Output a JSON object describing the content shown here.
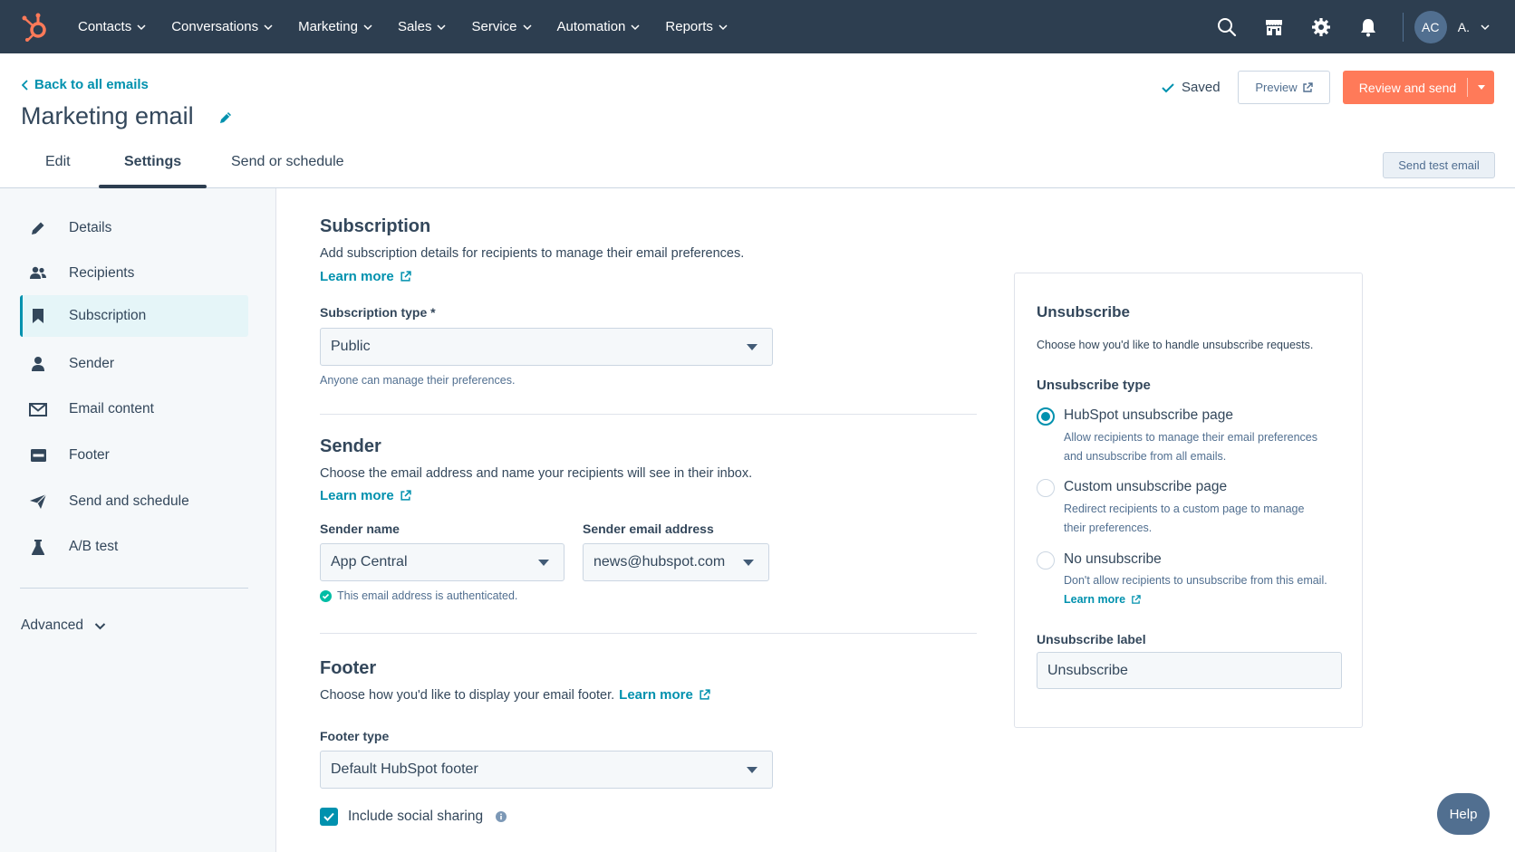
{
  "nav": {
    "menu": [
      "Contacts",
      "Conversations",
      "Marketing",
      "Sales",
      "Service",
      "Automation",
      "Reports"
    ],
    "avatar_initials": "AC",
    "account_name": "A.",
    "brand_color": "#ff7a59",
    "bar_color": "#2d3e50"
  },
  "header": {
    "back_label": "Back to all emails",
    "title": "Marketing email",
    "saved_label": "Saved",
    "preview_label": "Preview",
    "review_label": "Review and send"
  },
  "tabs": {
    "items": [
      "Edit",
      "Settings",
      "Send or schedule"
    ],
    "active": "Settings",
    "send_test_label": "Send test email"
  },
  "sidebar": {
    "items": [
      {
        "label": "Details",
        "icon": "pencil-icon"
      },
      {
        "label": "Recipients",
        "icon": "people-icon"
      },
      {
        "label": "Subscription",
        "icon": "bookmark-icon"
      },
      {
        "label": "Sender",
        "icon": "person-icon"
      },
      {
        "label": "Email content",
        "icon": "envelope-icon"
      },
      {
        "label": "Footer",
        "icon": "footer-icon"
      },
      {
        "label": "Send and schedule",
        "icon": "paper-plane-icon"
      },
      {
        "label": "A/B test",
        "icon": "flask-icon"
      }
    ],
    "active": "Subscription",
    "advanced_label": "Advanced"
  },
  "subscription": {
    "heading": "Subscription",
    "description": "Add subscription details for recipients to manage their email preferences.",
    "learn_more": "Learn more",
    "type_label": "Subscription type *",
    "type_value": "Public",
    "type_help": "Anyone can manage their preferences."
  },
  "sender": {
    "heading": "Sender",
    "description": "Choose the email address and name your recipients will see in their inbox.",
    "learn_more": "Learn more",
    "name_label": "Sender name",
    "name_value": "App Central",
    "email_label": "Sender email address",
    "email_value": "news@hubspot.com",
    "auth_text": "This email address is authenticated."
  },
  "footer": {
    "heading": "Footer",
    "description": "Choose how you'd like to display your email footer.",
    "learn_more": "Learn more",
    "type_label": "Footer type",
    "type_value": "Default HubSpot footer",
    "social_label": "Include social sharing",
    "social_checked": true
  },
  "unsubscribe": {
    "heading": "Unsubscribe",
    "description": "Choose how you'd like to handle unsubscribe requests.",
    "type_label": "Unsubscribe type",
    "options": [
      {
        "label": "HubSpot unsubscribe page",
        "desc1": "Allow recipients to manage their email preferences",
        "desc2": "and unsubscribe from all emails.",
        "checked": true
      },
      {
        "label": "Custom unsubscribe page",
        "desc1": "Redirect recipients to a custom page to manage",
        "desc2": "their preferences.",
        "checked": false
      },
      {
        "label": "No unsubscribe",
        "desc1": "Don't allow recipients to unsubscribe from this email.",
        "desc2": "",
        "checked": false
      }
    ],
    "learn_more": "Learn more",
    "label_label": "Unsubscribe label",
    "label_value": "Unsubscribe"
  },
  "help_label": "Help",
  "colors": {
    "link": "#0091ae",
    "text": "#33475b",
    "success": "#00bda5"
  }
}
